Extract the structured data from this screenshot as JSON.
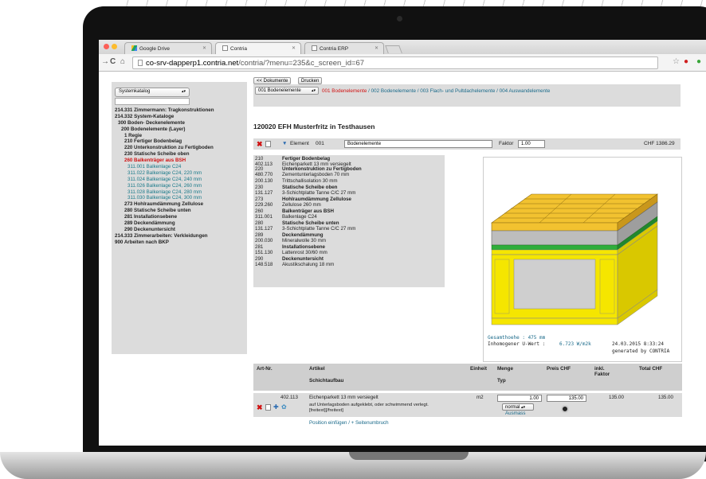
{
  "browser": {
    "tabs": [
      {
        "label": "Google Drive",
        "icon": "google-drive-icon"
      },
      {
        "label": "Contria",
        "icon": "page-icon"
      },
      {
        "label": "Contria ERP",
        "icon": "page-icon"
      }
    ],
    "url_host": "co-srv-dapperp1.contria.net",
    "url_path": "/contria/?menu=235&c_screen_id=67"
  },
  "sidebar": {
    "select_value": "Systemkatalog",
    "tree": [
      {
        "text": "214.331 Zimmermann: Tragkonstruktionen",
        "style": "bold"
      },
      {
        "text": "214.332 System-Kataloge",
        "style": "bold"
      },
      {
        "text": "300 Boden- Deckenelemente",
        "style": "bold",
        "indent": 1
      },
      {
        "text": "200 Bodenelemente (Layer)",
        "style": "bold",
        "indent": 2
      },
      {
        "text": "1 Regie",
        "style": "bold",
        "indent": 3
      },
      {
        "text": "210 Fertiger Bodenbelag",
        "style": "bold",
        "indent": 3
      },
      {
        "text": "220 Unterkonstruktion zu Fertigboden",
        "style": "bold",
        "indent": 3
      },
      {
        "text": "230 Statische Scheibe oben",
        "style": "bold",
        "indent": 3
      },
      {
        "text": "260 Balkenträger aus BSH",
        "style": "red",
        "indent": 3
      },
      {
        "text": "311.001 Balkenlage C24",
        "style": "teal",
        "indent": 4
      },
      {
        "text": "311.022 Balkenlage C24, 220 mm",
        "style": "teal",
        "indent": 4
      },
      {
        "text": "311.024 Balkenlage C24, 240 mm",
        "style": "teal",
        "indent": 4
      },
      {
        "text": "311.026 Balkenlage C24, 260 mm",
        "style": "teal",
        "indent": 4
      },
      {
        "text": "311.028 Balkenlage C24, 280 mm",
        "style": "teal",
        "indent": 4
      },
      {
        "text": "311.030 Balkenlage C24, 300 mm",
        "style": "teal",
        "indent": 4
      },
      {
        "text": "273 Hohlraumdämmung Zellulose",
        "style": "bold",
        "indent": 3
      },
      {
        "text": "280 Statische Scheibe unten",
        "style": "bold",
        "indent": 3
      },
      {
        "text": "281 Installationsebene",
        "style": "bold",
        "indent": 3
      },
      {
        "text": "289 Deckendämmung",
        "style": "bold",
        "indent": 3
      },
      {
        "text": "290 Deckenuntersicht",
        "style": "bold",
        "indent": 3
      },
      {
        "text": "214.333 Zimmerarbeiten: Verkleidungen",
        "style": "bold"
      },
      {
        "text": "900 Arbeiten nach BKP",
        "style": "bold"
      }
    ]
  },
  "toolbar": {
    "back_label": "<< Dokumente",
    "print_label": "Drucken",
    "element_select": "001 Bodenelemente",
    "breadcrumb_active": "001 Bodenelemente",
    "breadcrumb_rest": " / 002 Bodenelemente / 003 Flach- und Pultdachelemente / 004 Auswandelemente"
  },
  "project": {
    "title": "120020 EFH Musterfritz in Testhausen",
    "element_label": "Element",
    "element_number": "001",
    "element_name": "Bodenelemente",
    "faktor_label": "Faktor",
    "faktor_value": "1.00",
    "total": "CHF 1386.29"
  },
  "layers": [
    {
      "code": "210",
      "sub": "402.113",
      "title": "Fertiger Bodenbelag",
      "desc": "Eichenparkett 13 mm versiegelt"
    },
    {
      "code": "220",
      "sub": "480.770",
      "title": "Unterkonstruktion zu Fertigboden",
      "desc": "Zementunterlagsboden 70 mm"
    },
    {
      "code": "200.130",
      "sub": "",
      "title": "",
      "desc": "Trittschallisolation 30 mm"
    },
    {
      "code": "230",
      "sub": "131.127",
      "title": "Statische Scheibe oben",
      "desc": "3-Schichtplatte Tanne C/C 27 mm"
    },
    {
      "code": "273",
      "sub": "229.260",
      "title": "Hohlraumdämmung Zellulose",
      "desc": "Zellulose 260 mm"
    },
    {
      "code": "260",
      "sub": "311.001",
      "title": "Balkenträger aus BSH",
      "desc": "Balkenlage C24"
    },
    {
      "code": "280",
      "sub": "131.127",
      "title": "Statische Scheibe unten",
      "desc": "3-Schichtplatte Tanne C/C 27 mm"
    },
    {
      "code": "289",
      "sub": "200.030",
      "title": "Deckendämmung",
      "desc": "Mineralwolle 30 mm"
    },
    {
      "code": "281",
      "sub": "151.130",
      "title": "Installationsebene",
      "desc": "Lattenrost 30/60 mm"
    },
    {
      "code": "290",
      "sub": "148.518",
      "title": "Deckenuntersicht",
      "desc": "Akustikschalung 18 mm"
    }
  ],
  "diagram": {
    "gesamthoehe": "Gesamthoehe :  475 mm",
    "uwert_label": "Inhomogener U-Wert :",
    "uwert_value": "6.723 W/m2k",
    "date": "24.03.2015   8:33:24",
    "generated": "generated by CONTRIA",
    "colors": {
      "wood": "#f2c230",
      "wood_dark": "#c9971c",
      "grey": "#bdbdbd",
      "green": "#2fae3a",
      "frame": "#f5e600"
    }
  },
  "table": {
    "headers": {
      "art": "Art-Nr.",
      "artikel": "Artikel",
      "schicht": "Schichtaufbau",
      "einheit": "Einheit",
      "menge": "Menge",
      "typ": "Typ",
      "preis": "Preis CHF",
      "inkl": "inkl.",
      "faktor": "Faktor",
      "total": "Total CHF"
    },
    "row": {
      "art": "402.113",
      "artikel": "Eichenparkett 13 mm versiegelt",
      "detail1": "auf Unterlagsboden aufgeklebt, oder schwimmend verlegt.",
      "detail2": "[freitext][/freitext]",
      "einheit": "m2",
      "menge": "1.00",
      "typ": "normal",
      "ausmass": "Ausmass",
      "preis": "135.00",
      "inkl": "135.00",
      "total": "135.00"
    },
    "footer_link": "Position einfügen  / + Seitenumbruch"
  }
}
